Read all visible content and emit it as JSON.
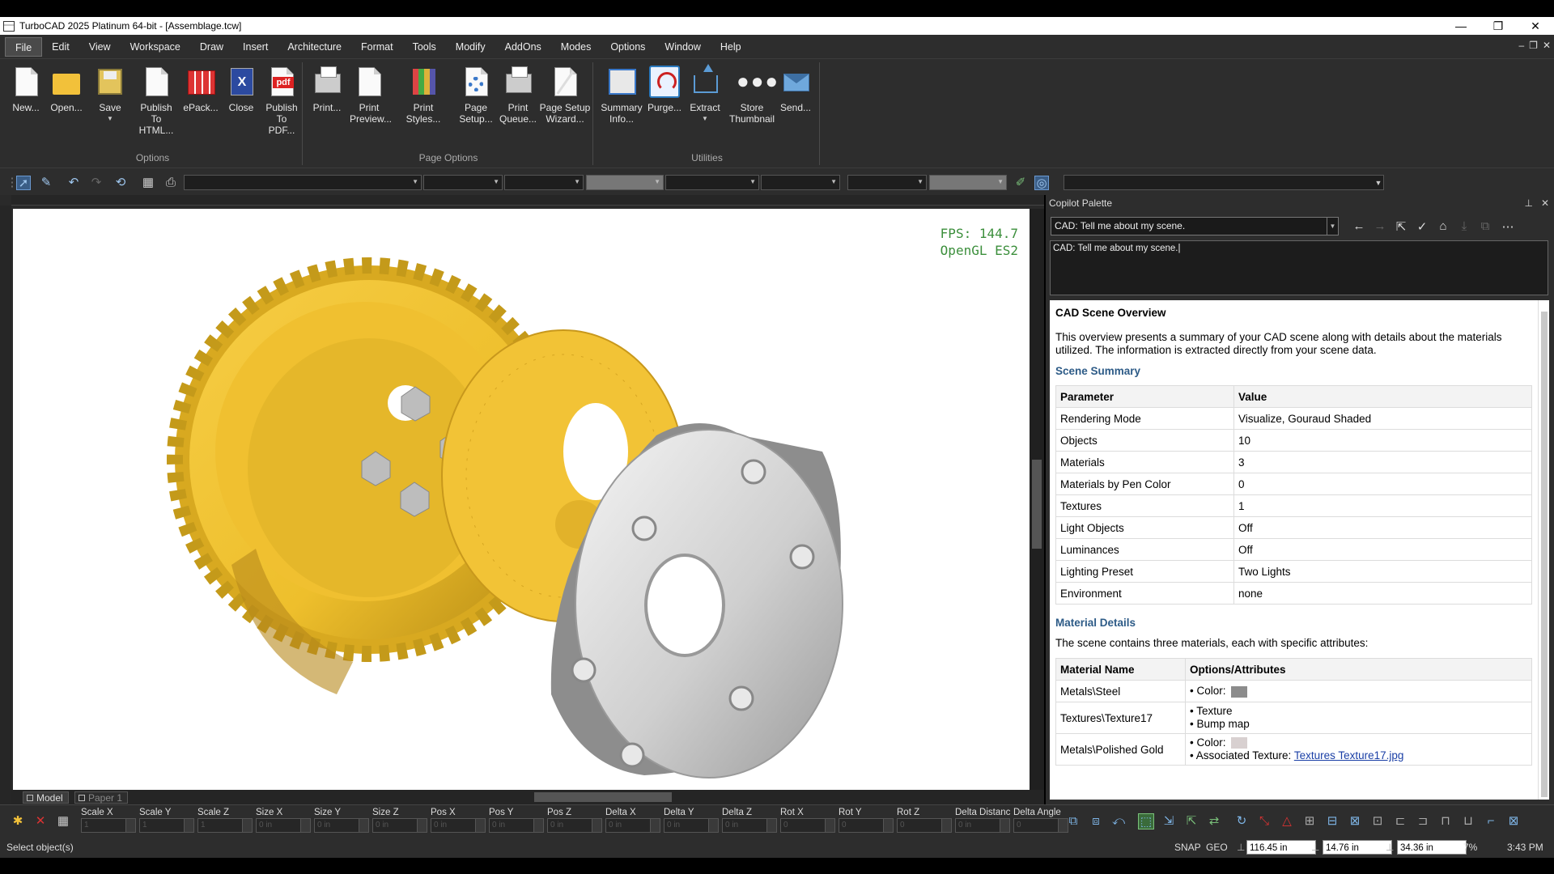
{
  "window": {
    "title": "TurboCAD 2025 Platinum 64-bit - [Assemblage.tcw]",
    "buttons": {
      "minimize": "—",
      "restore": "❐",
      "close": "✕"
    }
  },
  "menubar": {
    "items": [
      "File",
      "Edit",
      "View",
      "Workspace",
      "Draw",
      "Insert",
      "Architecture",
      "Format",
      "Tools",
      "Modify",
      "AddOns",
      "Modes",
      "Options",
      "Window",
      "Help"
    ],
    "active": "File",
    "mdi_controls": [
      "‒",
      "❐",
      "✕"
    ]
  },
  "ribbon": {
    "groups": [
      {
        "label": "Options",
        "buttons": [
          {
            "label1": "New...",
            "label2": "",
            "icon": "new-document-icon"
          },
          {
            "label1": "Open...",
            "label2": "",
            "icon": "open-folder-icon"
          },
          {
            "label1": "Save",
            "label2": "",
            "icon": "save-icon"
          },
          {
            "label1": "Publish",
            "label2": "To HTML...",
            "icon": "publish-html-icon"
          },
          {
            "label1": "ePack...",
            "label2": "",
            "icon": "epack-icon"
          },
          {
            "label1": "Close",
            "label2": "",
            "icon": "close-document-icon"
          },
          {
            "label1": "Publish",
            "label2": "To PDF...",
            "icon": "publish-pdf-icon"
          }
        ]
      },
      {
        "label": "Page Options",
        "buttons": [
          {
            "label1": "Print...",
            "label2": "",
            "icon": "print-icon"
          },
          {
            "label1": "Print",
            "label2": "Preview...",
            "icon": "print-preview-icon"
          },
          {
            "label1": "Print Styles...",
            "label2": "",
            "icon": "print-styles-icon"
          },
          {
            "label1": "Page",
            "label2": "Setup...",
            "icon": "page-setup-icon"
          },
          {
            "label1": "Print",
            "label2": "Queue...",
            "icon": "print-queue-icon"
          },
          {
            "label1": "Page Setup",
            "label2": "Wizard...",
            "icon": "page-setup-wizard-icon"
          }
        ]
      },
      {
        "label": "Utilities",
        "buttons": [
          {
            "label1": "Summary",
            "label2": "Info...",
            "icon": "summary-info-icon"
          },
          {
            "label1": "Purge...",
            "label2": "",
            "icon": "purge-icon"
          },
          {
            "label1": "Extract",
            "label2": "",
            "icon": "extract-icon"
          },
          {
            "label1": "Store",
            "label2": "Thumbnail",
            "icon": "store-thumbnail-icon"
          },
          {
            "label1": "Send...",
            "label2": "",
            "icon": "send-mail-icon"
          }
        ]
      }
    ],
    "pdf_badge": "pdf",
    "close_badge": "X"
  },
  "viewport": {
    "fps": "FPS: 144.7",
    "renderer": "OpenGL ES2",
    "tabs": [
      "Model",
      "Paper 1"
    ]
  },
  "copilot": {
    "title": "Copilot Palette",
    "combo_value": "CAD: Tell me about my scene.",
    "prompt_text": "CAD: Tell me about my scene.",
    "response": {
      "heading": "CAD Scene Overview",
      "intro": "This overview presents a summary of your CAD scene along with details about the materials utilized. The information is extracted directly from your scene data.",
      "summary_heading": "Scene Summary",
      "summary_cols": [
        "Parameter",
        "Value"
      ],
      "summary_rows": [
        [
          "Rendering Mode",
          "Visualize, Gouraud Shaded"
        ],
        [
          "Objects",
          "10"
        ],
        [
          "Materials",
          "3"
        ],
        [
          "Materials by Pen Color",
          "0"
        ],
        [
          "Textures",
          "1"
        ],
        [
          "Light Objects",
          "Off"
        ],
        [
          "Luminances",
          "Off"
        ],
        [
          "Lighting Preset",
          "Two Lights"
        ],
        [
          "Environment",
          "none"
        ]
      ],
      "materials_heading": "Material Details",
      "materials_intro": "The scene contains three materials, each with specific attributes:",
      "materials_cols": [
        "Material Name",
        "Options/Attributes"
      ],
      "materials": [
        {
          "name": "Metals\\Steel",
          "attrs": [
            "• Color:"
          ],
          "swatch": "#8c8c8c"
        },
        {
          "name": "Textures\\Texture17",
          "attrs": [
            "• Texture",
            "• Bump map"
          ],
          "swatch": ""
        },
        {
          "name": "Metals\\Polished Gold",
          "attrs": [
            "• Color:",
            "• Associated Texture: "
          ],
          "swatch": "#d8d0d0",
          "link": "Textures Texture17.jpg"
        }
      ]
    }
  },
  "inspector": {
    "fields": [
      "Scale X",
      "Scale Y",
      "Scale Z",
      "Size X",
      "Size Y",
      "Size Z",
      "Pos X",
      "Pos Y",
      "Pos Z",
      "Delta X",
      "Delta Y",
      "Delta Z",
      "Rot X",
      "Rot Y",
      "Rot Z",
      "Delta Distanc",
      "Delta Angle"
    ],
    "placeholders": [
      "1",
      "1",
      "1",
      "0 in",
      "0 in",
      "0 in",
      "0 in",
      "0 in",
      "0 in",
      "0 in",
      "0 in",
      "0 in",
      "0",
      "0",
      "0",
      "0 in",
      "0"
    ]
  },
  "status": {
    "message": "Select object(s)",
    "snap": "SNAP",
    "geo": "GEO",
    "x": "116.45 in",
    "y": "14.76 in",
    "z": "34.36 in",
    "zoom": "7%",
    "time": "3:43 PM"
  },
  "colors": {
    "gear_gold": "#f0c030",
    "flange_steel": "#c8c8c8",
    "accent": "#2d5b87"
  }
}
